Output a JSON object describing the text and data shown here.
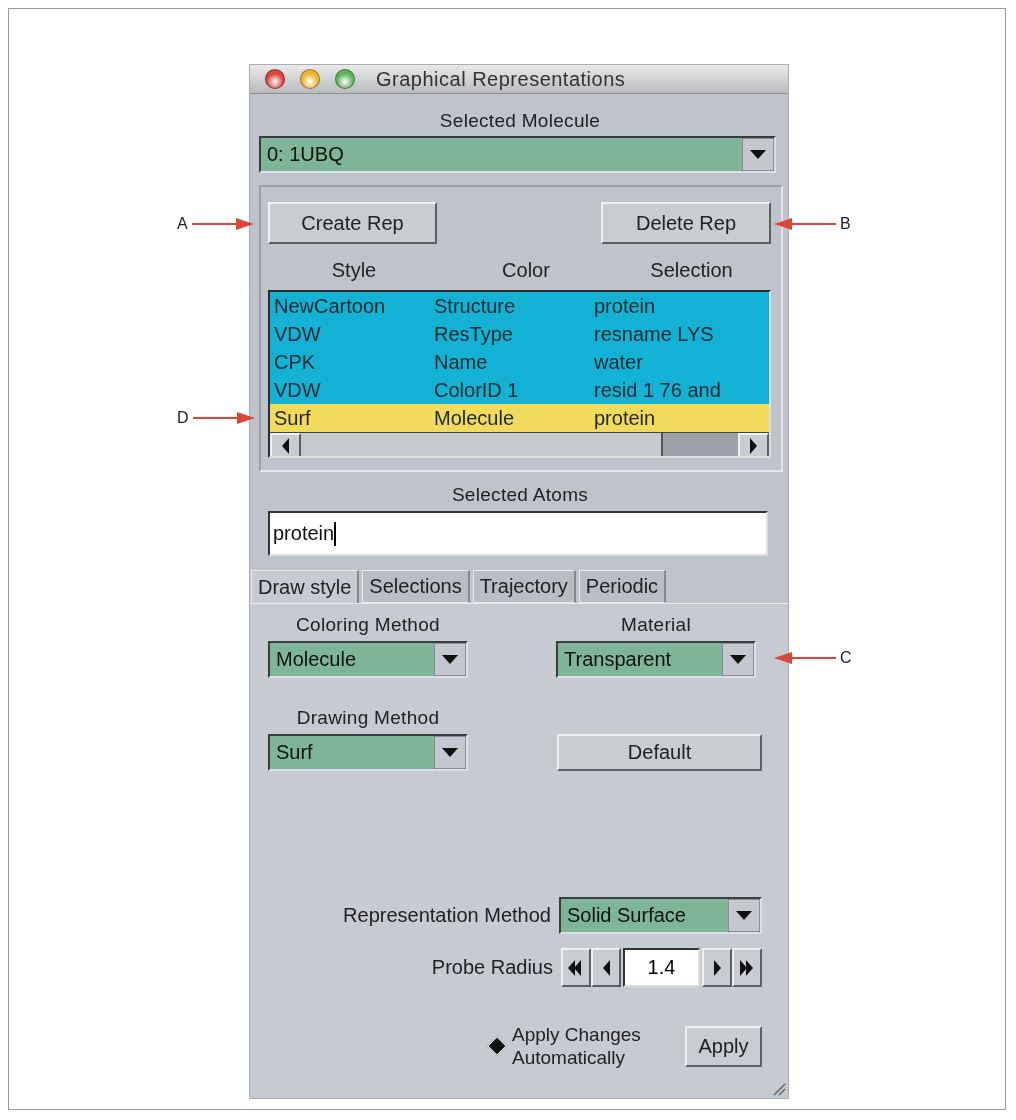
{
  "window": {
    "title": "Graphical Representations"
  },
  "selected_molecule": {
    "label": "Selected Molecule",
    "value": "0: 1UBQ"
  },
  "reps": {
    "buttons": [
      "Create Rep",
      "Delete Rep"
    ],
    "columns": [
      "Style",
      "Color",
      "Selection"
    ],
    "rows": [
      {
        "cells": [
          "NewCartoon",
          "Structure",
          "protein"
        ],
        "selected": false
      },
      {
        "cells": [
          "VDW",
          "ResType",
          "resname LYS"
        ],
        "selected": false
      },
      {
        "cells": [
          "CPK",
          "Name",
          "water"
        ],
        "selected": false
      },
      {
        "cells": [
          "VDW",
          "ColorID 1",
          "resid 1 76 and"
        ],
        "selected": false
      },
      {
        "cells": [
          "Surf",
          "Molecule",
          "protein"
        ],
        "selected": true
      }
    ]
  },
  "selected_atoms": {
    "label": "Selected Atoms",
    "value": "protein"
  },
  "tabs": [
    {
      "label": "Draw style",
      "selected": true
    },
    {
      "label": "Selections",
      "selected": false
    },
    {
      "label": "Trajectory",
      "selected": false
    },
    {
      "label": "Periodic",
      "selected": false
    }
  ],
  "draw_style": {
    "coloring_method": {
      "label": "Coloring Method",
      "value": "Molecule"
    },
    "material": {
      "label": "Material",
      "value": "Transparent"
    },
    "drawing_method": {
      "label": "Drawing Method",
      "value": "Surf"
    },
    "default_button": "Default",
    "representation_method": {
      "label": "Representation Method",
      "value": "Solid Surface"
    },
    "probe_radius": {
      "label": "Probe Radius",
      "value": "1.4"
    },
    "apply_automatically": {
      "label": "Apply Changes Automatically",
      "checked": true
    },
    "apply_button": "Apply"
  },
  "annotations": [
    {
      "label": "A",
      "kind": "left"
    },
    {
      "label": "B",
      "kind": "right"
    },
    {
      "label": "D",
      "kind": "left"
    },
    {
      "label": "C",
      "kind": "right"
    }
  ]
}
